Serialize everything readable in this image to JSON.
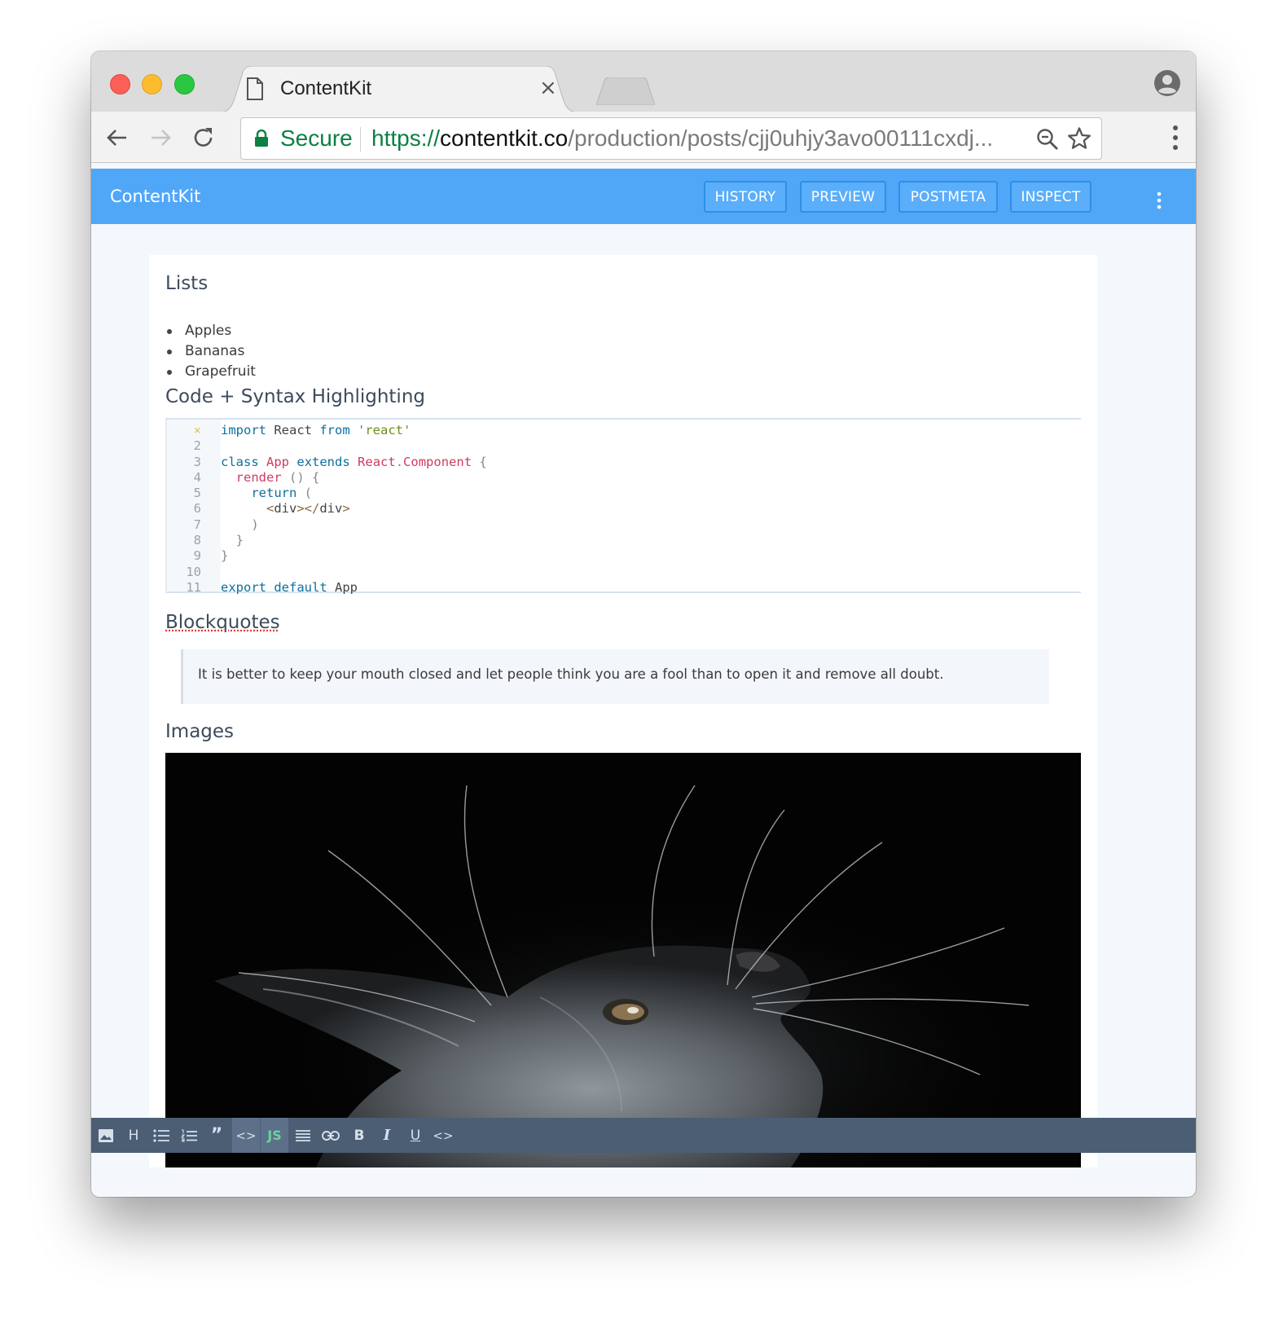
{
  "browser": {
    "tab_title": "ContentKit",
    "tab_close": "×",
    "secure_label": "Secure",
    "url_scheme": "https://",
    "url_host": "contentkit.co",
    "url_path": "/production/posts/cjj0uhjy3avo00111cxdj..."
  },
  "app": {
    "brand": "ContentKit",
    "buttons": {
      "history": "HISTORY",
      "preview": "PREVIEW",
      "postmeta": "POSTMETA",
      "inspect": "INSPECT"
    },
    "accent_color": "#50a7f8"
  },
  "document": {
    "lists_heading": "Lists",
    "list_items": [
      "Apples",
      "Bananas",
      "Grapefruit"
    ],
    "code_heading": "Code + Syntax Highlighting",
    "code_line_numbers": [
      "×",
      "2",
      "3",
      "4",
      "5",
      "6",
      "7",
      "8",
      "9",
      "10",
      "11"
    ],
    "blockquotes_heading": "Blockquotes",
    "blockquote_text": "It is better to keep your mouth closed and let people think you are a fool than to open it and remove all doubt.",
    "images_heading": "Images"
  },
  "editor_toolbar": {
    "heading_label": "H",
    "js_label": "JS",
    "bold_label": "B",
    "italic_label": "I",
    "underline_label": "U",
    "icons": [
      "image-icon",
      "heading-icon",
      "bulleted-list-icon",
      "numbered-list-icon",
      "quote-icon",
      "code-icon",
      "js-icon",
      "align-icon",
      "link-icon",
      "bold-icon",
      "italic-icon",
      "underline-icon",
      "embed-code-icon"
    ]
  }
}
